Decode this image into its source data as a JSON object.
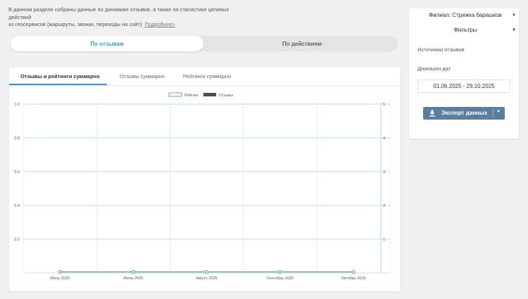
{
  "intro": {
    "line1": "В данном разделе собраны данные по динамике отзывов, а также по статистике целевых действий",
    "line2": "из геосервисов (маршруты, звонки, переходы на сайт)",
    "more_link": "Подробнее>"
  },
  "segment": {
    "reviews_label": "По отзывам",
    "actions_label": "По действиям"
  },
  "tabs": [
    {
      "label": "Отзывы и рейтинги суммарно",
      "active": true
    },
    {
      "label": "Отзывы суммарно",
      "active": false
    },
    {
      "label": "Рейтинги суммарно",
      "active": false
    }
  ],
  "panel": {
    "branch_label": "Филиал: Стрижка барашков",
    "filters_label": "Фильтры",
    "sources_label": "Источники отзывов",
    "range_label": "Диапазон дат",
    "date_range": "01.06.2025 - 29.10.2025",
    "export_label": "Экспорт данных"
  },
  "chart_data": {
    "type": "line",
    "categories": [
      "Июнь 2025",
      "Июль 2025",
      "Август 2025",
      "Сентябрь 2025",
      "Октябрь 2025"
    ],
    "legend": [
      "Рейтинг",
      "Отзывы"
    ],
    "series": [
      {
        "name": "Рейтинг",
        "values": [
          0,
          0,
          0,
          0,
          0
        ],
        "axis": "left",
        "color": "#5fb58a"
      },
      {
        "name": "Отзывы",
        "values": [
          0,
          0,
          0,
          0,
          0
        ],
        "axis": "right",
        "color": "#454c5a"
      }
    ],
    "y_left": {
      "ticks": [
        "0.2",
        "0.4",
        "0.6",
        "0.8",
        "1.0"
      ],
      "ylim": [
        0,
        1
      ]
    },
    "y_right": {
      "ticks": [
        "1",
        "2",
        "3",
        "4",
        "5"
      ],
      "ylim": [
        0,
        5
      ]
    },
    "grid": true,
    "legend_position": "top-center"
  }
}
